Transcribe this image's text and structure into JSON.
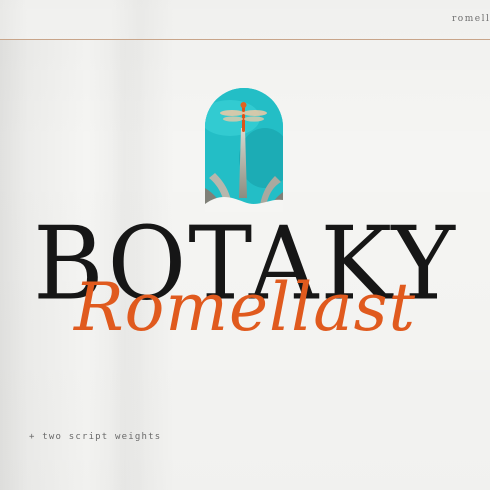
{
  "top_label": "romellast",
  "title": "BOTAKY",
  "script_title": "Romellast",
  "subtitle": "+ two script weights",
  "colors": {
    "accent": "#e05a1e",
    "title": "#161616",
    "arch": "#22bcc4"
  }
}
